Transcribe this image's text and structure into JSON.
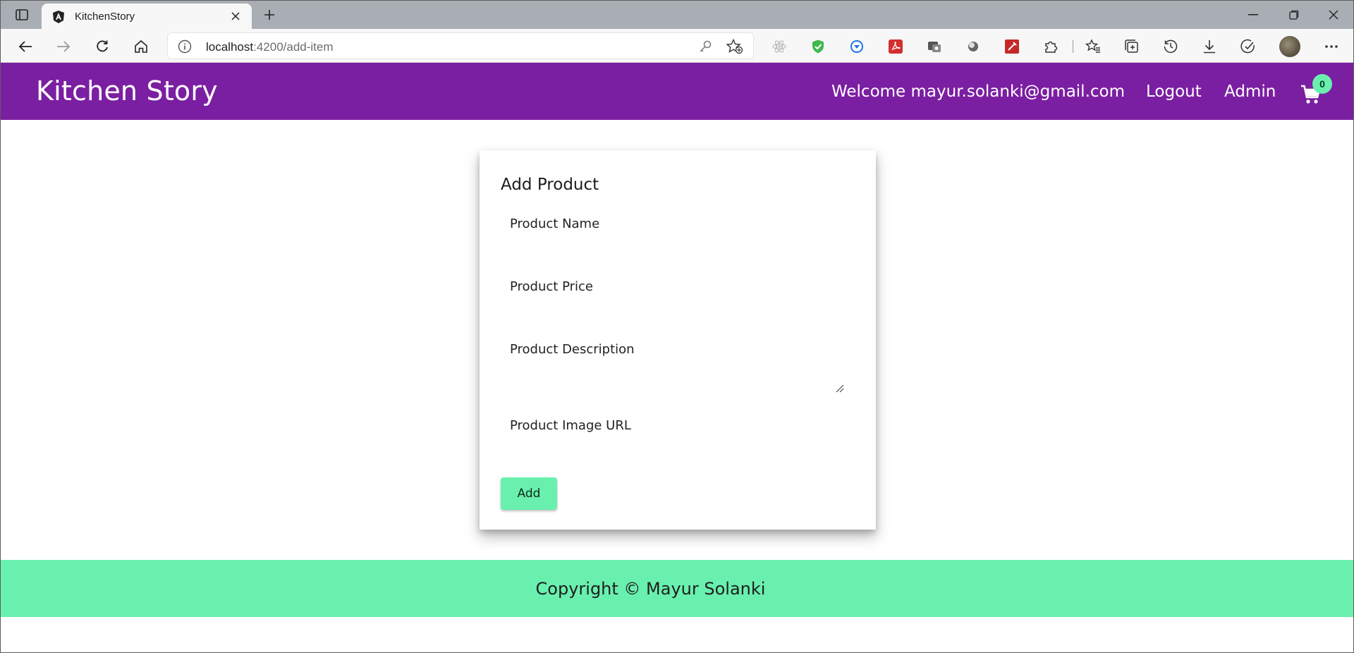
{
  "browser": {
    "tab_title": "KitchenStory",
    "url_host": "localhost",
    "url_rest": ":4200/add-item",
    "icons": {
      "sidebar": "sidebar-icon",
      "favicon": "angular-icon",
      "close": "close-icon",
      "new_tab": "plus-icon",
      "back": "back-arrow-icon",
      "forward": "forward-arrow-icon",
      "reload": "reload-icon",
      "home": "home-icon",
      "info": "info-icon",
      "key": "key-icon",
      "favorite": "add-favorite-icon"
    }
  },
  "header": {
    "brand": "Kitchen Story",
    "welcome": "Welcome mayur.solanki@gmail.com",
    "logout": "Logout",
    "admin": "Admin",
    "cart_count": "0",
    "brand_color": "#7b1fa2",
    "accent_color": "#69f0ae"
  },
  "form": {
    "title": "Add Product",
    "fields": [
      {
        "label": "Product Name",
        "value": ""
      },
      {
        "label": "Product Price",
        "value": ""
      },
      {
        "label": "Product Description",
        "value": ""
      },
      {
        "label": "Product Image URL",
        "value": ""
      }
    ],
    "submit_label": "Add"
  },
  "footer": {
    "text": "Copyright © Mayur Solanki"
  }
}
